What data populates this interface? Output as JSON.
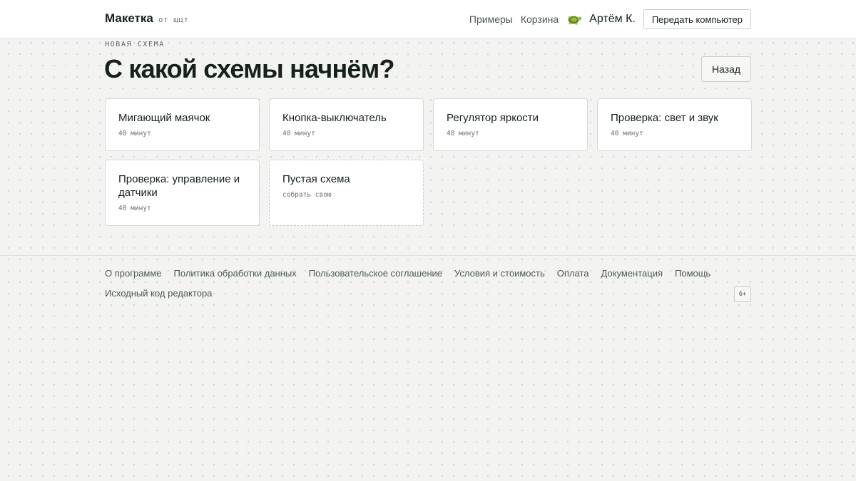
{
  "header": {
    "brand": "Макетка",
    "brand_sub": "от щцт",
    "nav": [
      "Примеры",
      "Корзина"
    ],
    "user_name": "Артём К.",
    "transfer_button": "Передать компьютер"
  },
  "main": {
    "eyebrow": "НОВАЯ СХЕМА",
    "title": "С какой схемы начнём?",
    "back_button": "Назад",
    "cards": [
      {
        "title": "Мигающий маячок",
        "meta": "40 минут"
      },
      {
        "title": "Кнопка-выключатель",
        "meta": "40 минут"
      },
      {
        "title": "Регулятор яркости",
        "meta": "40 минут"
      },
      {
        "title": "Проверка: свет и звук",
        "meta": "40 минут"
      },
      {
        "title": "Проверка: управление и датчики",
        "meta": "40 минут"
      },
      {
        "title": "Пустая схема",
        "meta": "собрать свою"
      }
    ]
  },
  "footer": {
    "links": [
      "О программе",
      "Политика обработки данных",
      "Пользовательское соглашение",
      "Условия и стоимость",
      "Оплата",
      "Документация",
      "Помощь"
    ],
    "source_link": "Исходный код редактора",
    "age_badge": "6+"
  },
  "colors": {
    "background": "#f3f4f2",
    "text": "#15211a",
    "muted": "#4c5951",
    "border": "#d6d9d4"
  },
  "icons": {
    "avatar": "turtle-icon"
  }
}
